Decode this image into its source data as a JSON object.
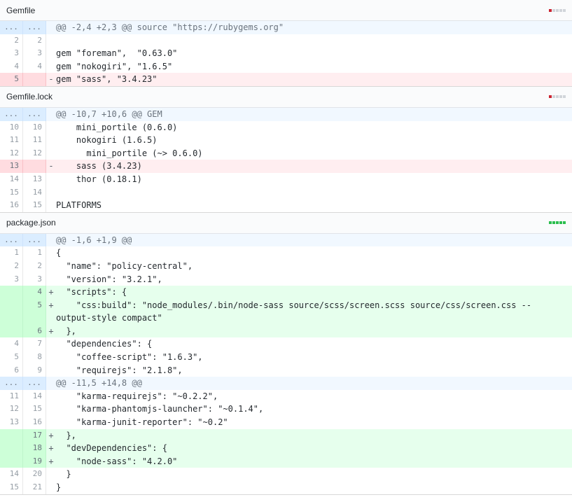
{
  "files": [
    {
      "name": "Gemfile",
      "diffstat": [
        "del",
        "neu",
        "neu",
        "neu",
        "neu"
      ],
      "lines": [
        {
          "type": "hunk",
          "old": "...",
          "new": "...",
          "sign": "",
          "text": "@@ -2,4 +2,3 @@ source \"https://rubygems.org\""
        },
        {
          "type": "ctx",
          "old": "2",
          "new": "2",
          "sign": "",
          "text": ""
        },
        {
          "type": "ctx",
          "old": "3",
          "new": "3",
          "sign": "",
          "text": "gem \"foreman\",  \"0.63.0\""
        },
        {
          "type": "ctx",
          "old": "4",
          "new": "4",
          "sign": "",
          "text": "gem \"nokogiri\", \"1.6.5\""
        },
        {
          "type": "del",
          "old": "5",
          "new": "",
          "sign": "-",
          "text": "gem \"sass\", \"3.4.23\""
        }
      ]
    },
    {
      "name": "Gemfile.lock",
      "diffstat": [
        "del",
        "neu",
        "neu",
        "neu",
        "neu"
      ],
      "lines": [
        {
          "type": "hunk",
          "old": "...",
          "new": "...",
          "sign": "",
          "text": "@@ -10,7 +10,6 @@ GEM"
        },
        {
          "type": "ctx",
          "old": "10",
          "new": "10",
          "sign": "",
          "text": "    mini_portile (0.6.0)"
        },
        {
          "type": "ctx",
          "old": "11",
          "new": "11",
          "sign": "",
          "text": "    nokogiri (1.6.5)"
        },
        {
          "type": "ctx",
          "old": "12",
          "new": "12",
          "sign": "",
          "text": "      mini_portile (~> 0.6.0)"
        },
        {
          "type": "del",
          "old": "13",
          "new": "",
          "sign": "-",
          "text": "    sass (3.4.23)"
        },
        {
          "type": "ctx",
          "old": "14",
          "new": "13",
          "sign": "",
          "text": "    thor (0.18.1)"
        },
        {
          "type": "ctx",
          "old": "15",
          "new": "14",
          "sign": "",
          "text": ""
        },
        {
          "type": "ctx",
          "old": "16",
          "new": "15",
          "sign": "",
          "text": "PLATFORMS"
        }
      ]
    },
    {
      "name": "package.json",
      "diffstat": [
        "add",
        "add",
        "add",
        "add",
        "add"
      ],
      "lines": [
        {
          "type": "hunk",
          "old": "...",
          "new": "...",
          "sign": "",
          "text": "@@ -1,6 +1,9 @@"
        },
        {
          "type": "ctx",
          "old": "1",
          "new": "1",
          "sign": "",
          "text": "{"
        },
        {
          "type": "ctx",
          "old": "2",
          "new": "2",
          "sign": "",
          "text": "  \"name\": \"policy-central\","
        },
        {
          "type": "ctx",
          "old": "3",
          "new": "3",
          "sign": "",
          "text": "  \"version\": \"3.2.1\","
        },
        {
          "type": "add",
          "old": "",
          "new": "4",
          "sign": "+",
          "text": "  \"scripts\": {"
        },
        {
          "type": "add",
          "old": "",
          "new": "5",
          "sign": "+",
          "text": "    \"css:build\": \"node_modules/.bin/node-sass source/scss/screen.scss source/css/screen.css --output-style compact\""
        },
        {
          "type": "add",
          "old": "",
          "new": "6",
          "sign": "+",
          "text": "  },"
        },
        {
          "type": "ctx",
          "old": "4",
          "new": "7",
          "sign": "",
          "text": "  \"dependencies\": {"
        },
        {
          "type": "ctx",
          "old": "5",
          "new": "8",
          "sign": "",
          "text": "    \"coffee-script\": \"1.6.3\","
        },
        {
          "type": "ctx",
          "old": "6",
          "new": "9",
          "sign": "",
          "text": "    \"requirejs\": \"2.1.8\","
        },
        {
          "type": "hunk",
          "old": "...",
          "new": "...",
          "sign": "",
          "text": "@@ -11,5 +14,8 @@"
        },
        {
          "type": "ctx",
          "old": "11",
          "new": "14",
          "sign": "",
          "text": "    \"karma-requirejs\": \"~0.2.2\","
        },
        {
          "type": "ctx",
          "old": "12",
          "new": "15",
          "sign": "",
          "text": "    \"karma-phantomjs-launcher\": \"~0.1.4\","
        },
        {
          "type": "ctx",
          "old": "13",
          "new": "16",
          "sign": "",
          "text": "    \"karma-junit-reporter\": \"~0.2\""
        },
        {
          "type": "add",
          "old": "",
          "new": "17",
          "sign": "+",
          "text": "  },"
        },
        {
          "type": "add",
          "old": "",
          "new": "18",
          "sign": "+",
          "text": "  \"devDependencies\": {"
        },
        {
          "type": "add",
          "old": "",
          "new": "19",
          "sign": "+",
          "text": "    \"node-sass\": \"4.2.0\""
        },
        {
          "type": "ctx",
          "old": "14",
          "new": "20",
          "sign": "",
          "text": "  }"
        },
        {
          "type": "ctx",
          "old": "15",
          "new": "21",
          "sign": "",
          "text": "}"
        }
      ]
    }
  ]
}
